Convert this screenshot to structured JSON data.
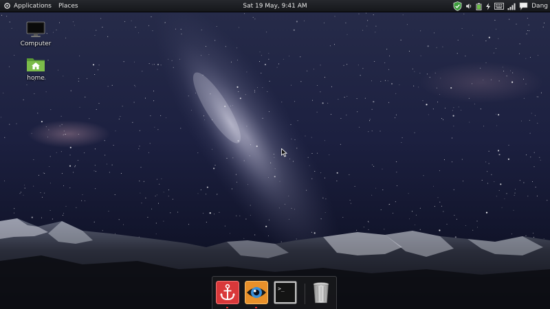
{
  "top_panel": {
    "menus": [
      {
        "label": "Applications"
      },
      {
        "label": "Places"
      }
    ],
    "clock": "Sat 19 May,  9:41 AM",
    "tray_icons": [
      "security-shield-icon",
      "volume-icon",
      "battery-icon",
      "power-icon",
      "keyboard-icon",
      "network-signal-icon",
      "chat-icon"
    ],
    "user_name": "Dang"
  },
  "desktop_icons": [
    {
      "label": "Computer",
      "icon": "computer-icon"
    },
    {
      "label": "home",
      "icon": "home-folder-icon"
    }
  ],
  "dock_items": [
    {
      "name": "anchor-app",
      "icon": "anchor-icon",
      "running": true
    },
    {
      "name": "eye-app",
      "icon": "eye-icon",
      "running": true
    },
    {
      "name": "terminal",
      "icon": "terminal-icon",
      "running": false
    },
    {
      "name": "trash",
      "icon": "trash-icon",
      "running": false
    }
  ],
  "terminal_prompt": ">_",
  "colors": {
    "panel": "#1c1d21",
    "sky_top": "#1b2140",
    "sky_bottom": "#070b1c",
    "dock_running_indicator": "#dd3333",
    "anchor_tile": "#d9383a",
    "eye_tile": "#e8902a"
  }
}
